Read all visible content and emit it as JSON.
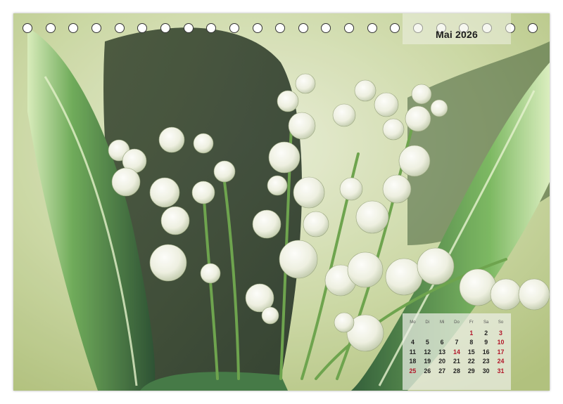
{
  "calendar": {
    "month_title": "Mai 2026",
    "weekdays": [
      "Mo",
      "Di",
      "Mi",
      "Do",
      "Fr",
      "Sa",
      "So"
    ],
    "weeks": [
      [
        "",
        "",
        "",
        "",
        "1",
        "2",
        "3"
      ],
      [
        "4",
        "5",
        "6",
        "7",
        "8",
        "9",
        "10"
      ],
      [
        "11",
        "12",
        "13",
        "14",
        "15",
        "16",
        "17"
      ],
      [
        "18",
        "19",
        "20",
        "21",
        "22",
        "23",
        "24"
      ],
      [
        "25",
        "26",
        "27",
        "28",
        "29",
        "30",
        "31"
      ]
    ],
    "highlighted_days": [
      "1",
      "3",
      "10",
      "14",
      "17",
      "24",
      "25",
      "31"
    ],
    "highlight_color": "#b2172a"
  },
  "photo": {
    "subject_icon": "lily-of-the-valley-icon",
    "colors": {
      "leaf_dark": "#1e5a2e",
      "leaf_light": "#8fc46a",
      "background": "#e9edd0",
      "flower": "#f4f4ec"
    }
  },
  "binding": {
    "hole_count": 23
  }
}
